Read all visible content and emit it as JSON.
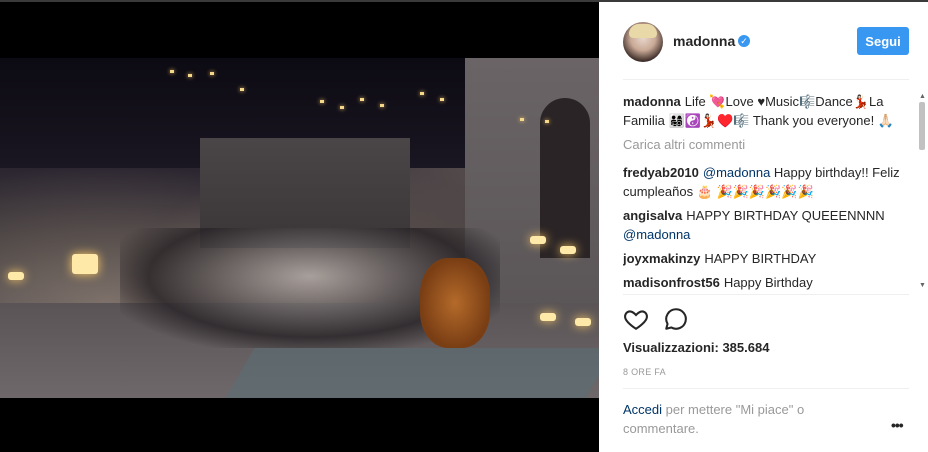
{
  "post": {
    "username": "madonna",
    "follow_label": "Segui",
    "views_label": "Visualizzazioni: 385.684",
    "time_ago": "8 ORE FA"
  },
  "comments": [
    {
      "author": "madonna",
      "text": "Life 💘Love ♥Music🎼Dance💃🏻La Familia 👨‍👩‍👧‍👦☯️💃🏻♥️🎼 Thank you everyone! 🙏🏻"
    },
    {
      "author": "fredyab2010",
      "mention": "@madonna",
      "text": " Happy birthday!! Feliz cumpleaños 🎂 🎉🎉🎉🎉🎉🎉"
    },
    {
      "author": "angisalva",
      "text": "HAPPY BIRTHDAY QUEEENNNN ",
      "mention": "@madonna"
    },
    {
      "author": "joyxmakinzy",
      "text": "HAPPY BIRTHDAY"
    },
    {
      "author": "madisonfrost56",
      "text": "Happy Birthday"
    }
  ],
  "load_more_label": "Carica altri commenti",
  "footer": {
    "login_link": "Accedi",
    "login_rest": " per mettere \"Mi piace\" o commentare."
  },
  "icons": {
    "verified": "verified-badge-icon",
    "like": "heart-icon",
    "comment": "comment-bubble-icon",
    "more": "more-options-icon"
  },
  "colors": {
    "accent": "#3897f0",
    "link": "#003569",
    "muted": "#999999",
    "text": "#262626"
  }
}
